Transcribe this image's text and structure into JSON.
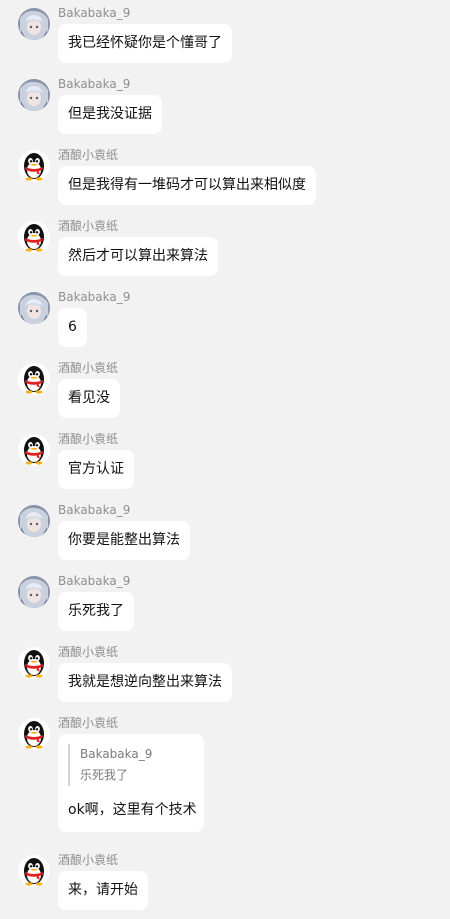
{
  "users": {
    "baka": "Bakabaka_9",
    "jiu": "酒酿小袁纸"
  },
  "messages": [
    {
      "sender": "Bakabaka_9",
      "avatar": "anime-avatar-icon",
      "text": "我已经怀疑你是个懂哥了"
    },
    {
      "sender": "Bakabaka_9",
      "avatar": "anime-avatar-icon",
      "text": "但是我没证据"
    },
    {
      "sender": "酒酿小袁纸",
      "avatar": "penguin-avatar-icon",
      "text": "但是我得有一堆码才可以算出来相似度"
    },
    {
      "sender": "酒酿小袁纸",
      "avatar": "penguin-avatar-icon",
      "text": "然后才可以算出来算法"
    },
    {
      "sender": "Bakabaka_9",
      "avatar": "anime-avatar-icon",
      "text": "6"
    },
    {
      "sender": "酒酿小袁纸",
      "avatar": "penguin-avatar-icon",
      "text": "看见没"
    },
    {
      "sender": "酒酿小袁纸",
      "avatar": "penguin-avatar-icon",
      "text": "官方认证"
    },
    {
      "sender": "Bakabaka_9",
      "avatar": "anime-avatar-icon",
      "text": "你要是能整出算法"
    },
    {
      "sender": "Bakabaka_9",
      "avatar": "anime-avatar-icon",
      "text": "乐死我了"
    },
    {
      "sender": "酒酿小袁纸",
      "avatar": "penguin-avatar-icon",
      "text": "我就是想逆向整出来算法"
    },
    {
      "sender": "酒酿小袁纸",
      "avatar": "penguin-avatar-icon",
      "quote": {
        "sender": "Bakabaka_9",
        "text": "乐死我了"
      },
      "text": "ok啊，这里有个技术"
    },
    {
      "sender": "酒酿小袁纸",
      "avatar": "penguin-avatar-icon",
      "text": "来，请开始"
    }
  ],
  "colors": {
    "background": "#f2f2f2",
    "bubble": "#ffffff",
    "sender_name": "#8f8f8f",
    "penguin_scarf": "#e02020"
  }
}
